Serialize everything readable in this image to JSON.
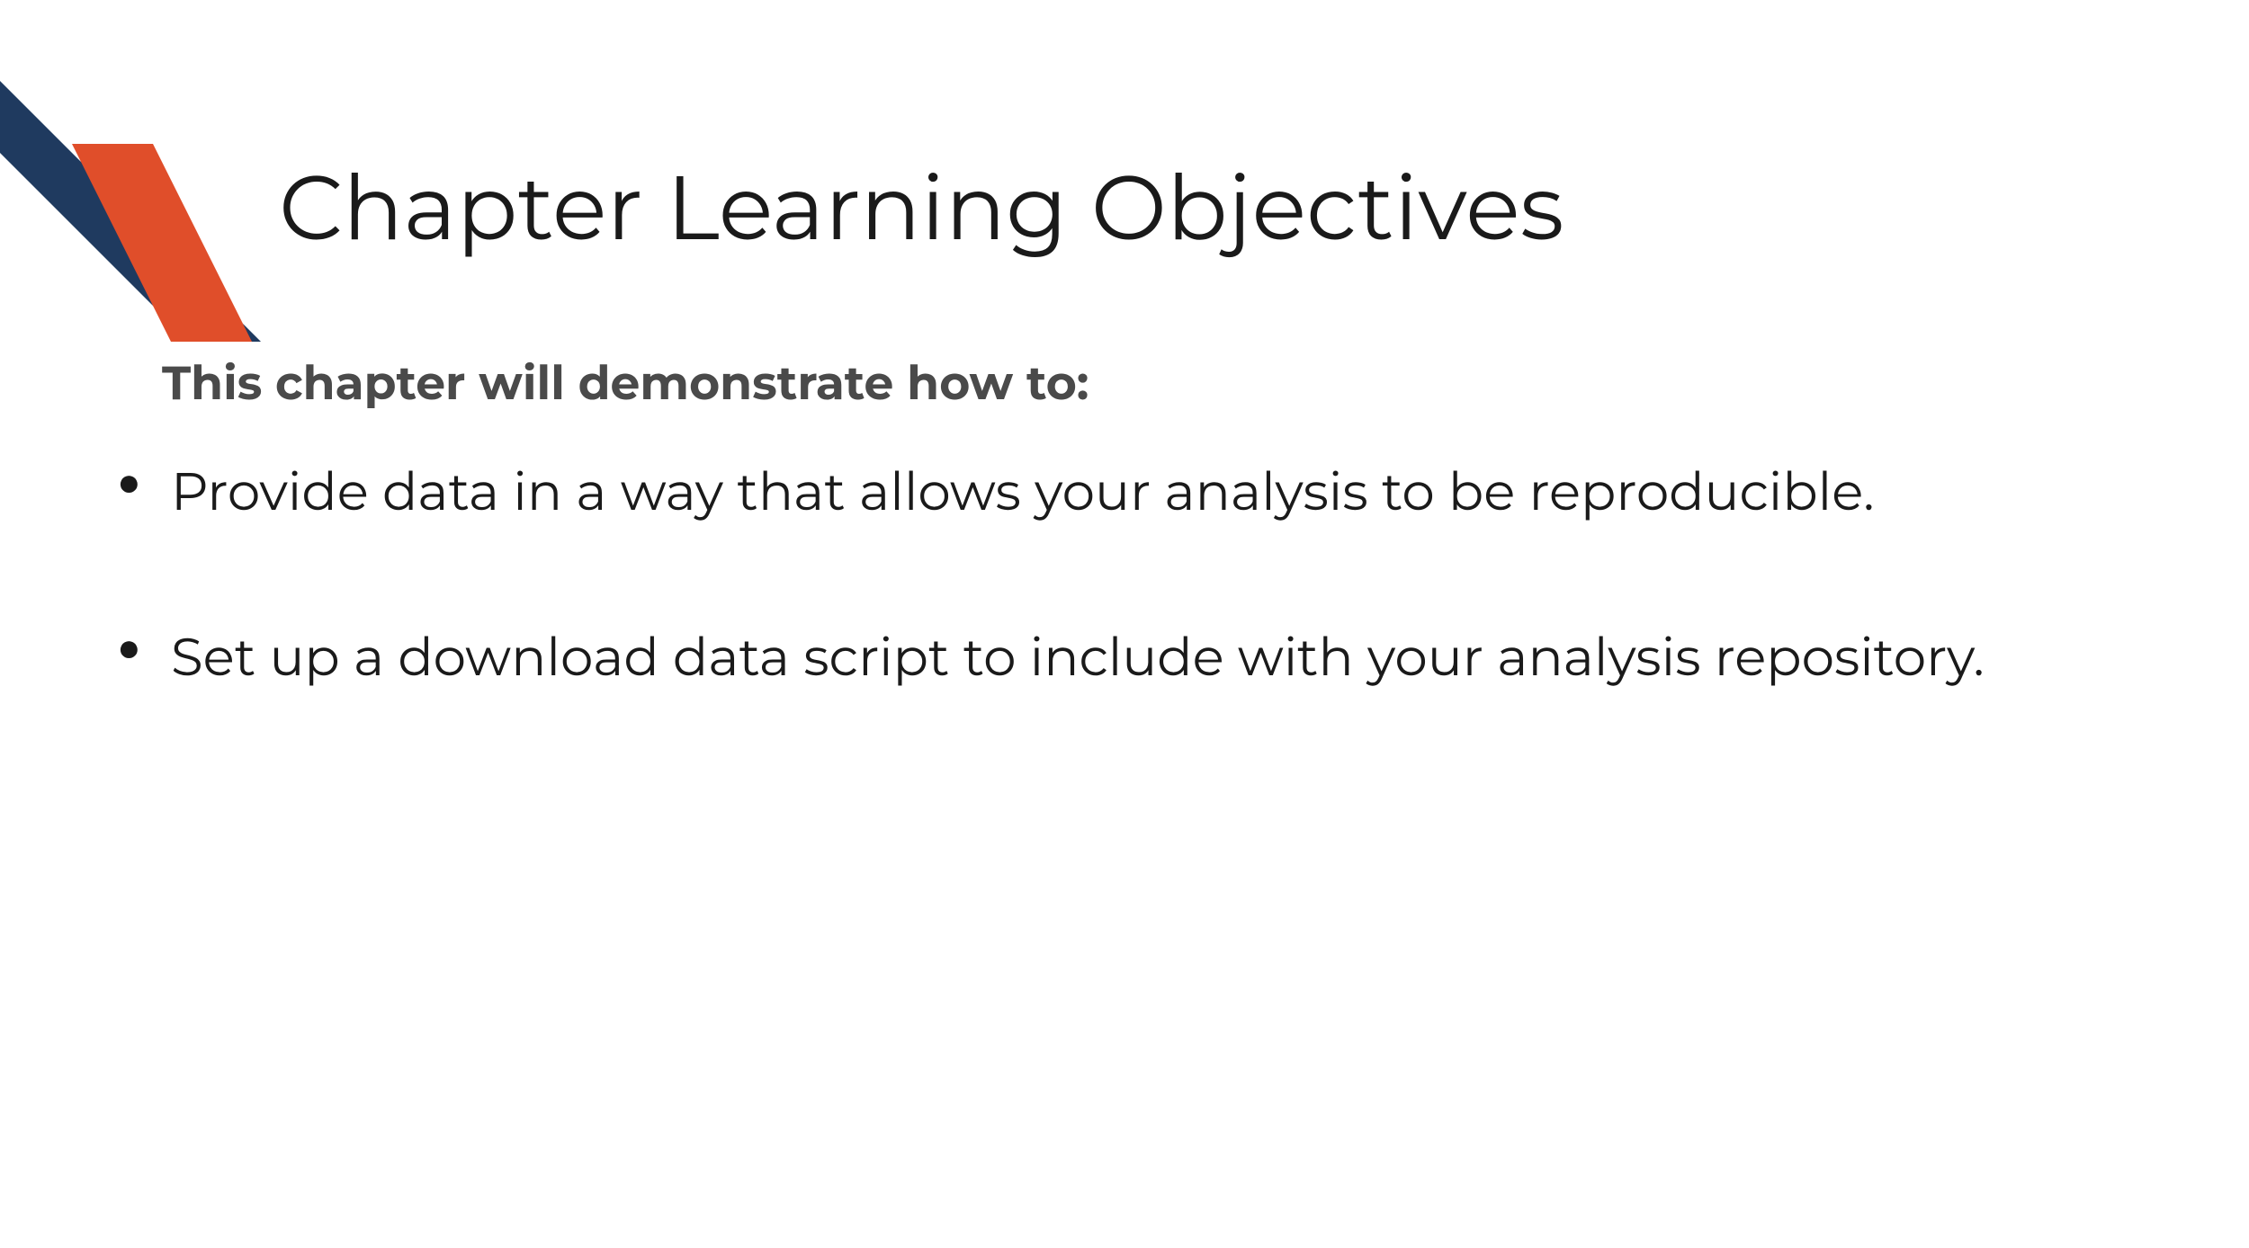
{
  "title": "Chapter Learning Objectives",
  "subtitle": "This chapter will demonstrate how to:",
  "bullets": [
    "Provide data in a way that allows your analysis to be reproducible.",
    "Set up a download data script to include with your analysis repository."
  ],
  "colors": {
    "navy": "#1f3a5f",
    "orange": "#e04e2a",
    "subtitle_text": "#4a4a4a",
    "body_text": "#1a1a1a"
  }
}
